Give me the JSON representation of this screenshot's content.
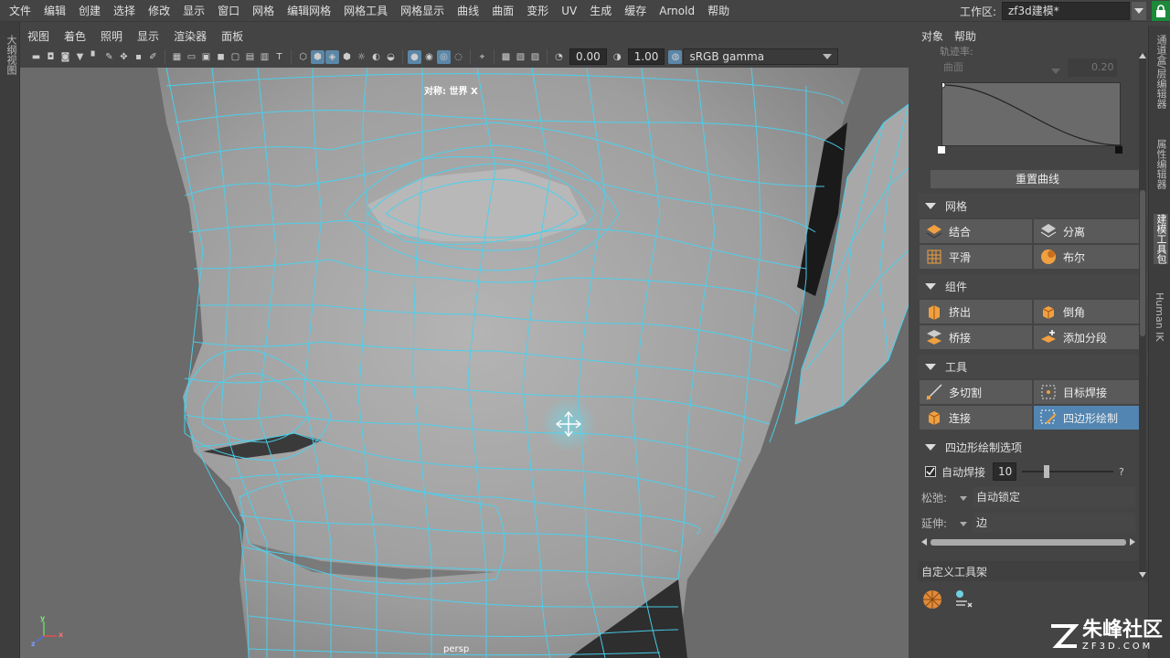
{
  "menu": [
    "文件",
    "编辑",
    "创建",
    "选择",
    "修改",
    "显示",
    "窗口",
    "网格",
    "编辑网格",
    "网格工具",
    "网格显示",
    "曲线",
    "曲面",
    "变形",
    "UV",
    "生成",
    "缓存",
    "Arnold",
    "帮助"
  ],
  "workspace": {
    "label": "工作区:",
    "value": "zf3d建模*"
  },
  "left_strip_label": "大纲视图",
  "panel_menu": [
    "视图",
    "着色",
    "照明",
    "显示",
    "渲染器",
    "面板"
  ],
  "toolbar": {
    "value1": "0.00",
    "value2": "1.00",
    "colorspace": "sRGB gamma"
  },
  "viewport": {
    "top_label": "对称: 世界 X",
    "camera": "persp",
    "axis_y": "y",
    "axis_x": "x",
    "axis_z": "z"
  },
  "right_panel": {
    "tabs": [
      "对象",
      "帮助"
    ],
    "faded_label": "轨迹率:",
    "faded_dropdown": "曲面",
    "faded_value": "0.20",
    "reset_curve": "重置曲线",
    "sections": {
      "mesh": {
        "title": "网格",
        "buttons": [
          "结合",
          "分离",
          "平滑",
          "布尔"
        ]
      },
      "components": {
        "title": "组件",
        "buttons": [
          "挤出",
          "倒角",
          "桥接",
          "添加分段"
        ]
      },
      "tools": {
        "title": "工具",
        "buttons": [
          "多切割",
          "目标焊接",
          "连接",
          "四边形绘制"
        ]
      },
      "quad_options": {
        "title": "四边形绘制选项"
      }
    },
    "auto_weld": {
      "label": "自动焊接",
      "value": "10",
      "help": "?",
      "slider_fraction": 0.25
    },
    "relax": {
      "label": "松弛:",
      "value": "自动锁定"
    },
    "extend": {
      "label": "延伸:",
      "value": "边"
    },
    "custom_shelf": "自定义工具架"
  },
  "right_strip_tabs": [
    "通道盒/层编辑器",
    "属性编辑器",
    "建模工具包",
    "Human IK"
  ],
  "watermark": {
    "brand": "朱峰社区",
    "url": "ZF3D.COM"
  },
  "colors": {
    "accent_blue": "#5285b1",
    "wire": "#48d2f0",
    "lock": "#1c8a3a"
  }
}
